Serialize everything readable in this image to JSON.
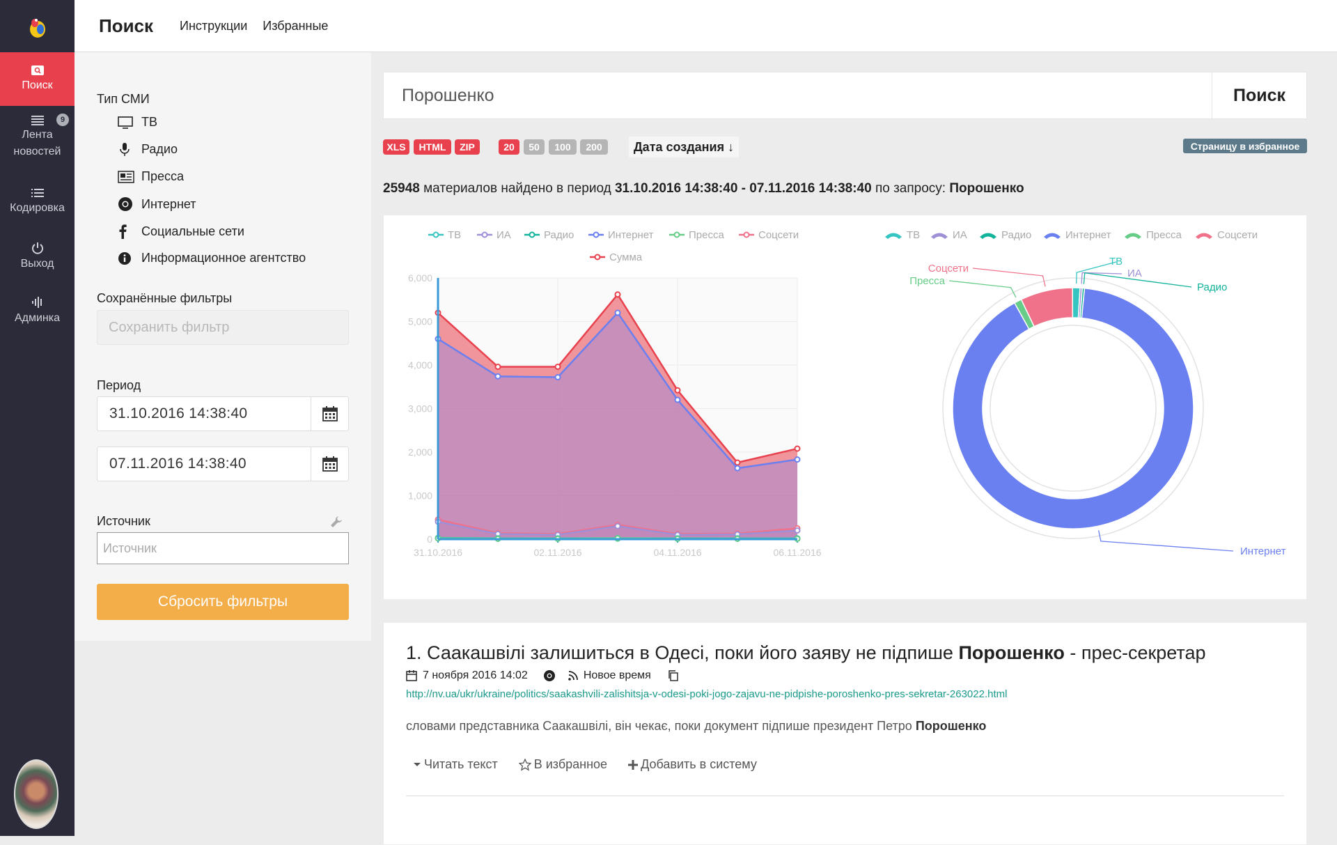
{
  "sidebar": {
    "items": [
      {
        "label": "Поиск",
        "icon": "search-icon"
      },
      {
        "label": "Лента новостей",
        "icon": "list-icon",
        "badge": "9"
      },
      {
        "label": "Кодировка",
        "icon": "list-icon"
      },
      {
        "label": "Выход",
        "icon": "power-icon"
      },
      {
        "label": "Админка",
        "icon": "equalizer-icon"
      }
    ]
  },
  "topbar": {
    "brand": "Поиск",
    "links": [
      "Инструкции",
      "Избранные"
    ]
  },
  "filters": {
    "media_type_label": "Тип СМИ",
    "media_types": [
      "ТВ",
      "Радио",
      "Пресса",
      "Интернет",
      "Социальные сети",
      "Информационное агентство"
    ],
    "saved_filters_label": "Сохранённые фильтры",
    "saved_filter_placeholder": "Сохранить фильтр",
    "period_label": "Период",
    "date_from": "31.10.2016 14:38:40",
    "date_to": "07.11.2016 14:38:40",
    "source_label": "Источник",
    "source_placeholder": "Источник",
    "reset_label": "Сбросить фильтры"
  },
  "search": {
    "query": "Порошенко",
    "button": "Поиск"
  },
  "toolbar": {
    "exports": [
      "XLS",
      "HTML",
      "ZIP"
    ],
    "page_sizes": [
      "20",
      "50",
      "100",
      "200"
    ],
    "sort_label": "Дата создания ↓",
    "fav_page_label": "Страницу в избранное"
  },
  "summary": {
    "count": "25948",
    "text1": " материалов найдено в период ",
    "period": "31.10.2016 14:38:40 - 07.11.2016 14:38:40",
    "text2": " по запросу: ",
    "query": "Порошенко"
  },
  "colors": {
    "accent": "#e8414d",
    "sidebar": "#2b2b3a",
    "orange": "#f3ad49"
  },
  "chart_data": [
    {
      "type": "area",
      "x": [
        "31.10.2016",
        "01.11.2016",
        "02.11.2016",
        "03.11.2016",
        "04.11.2016",
        "05.11.2016",
        "06.11.2016"
      ],
      "xticks": [
        "31.10.2016",
        "02.11.2016",
        "04.11.2016",
        "06.11.2016"
      ],
      "ylim": [
        0,
        6000
      ],
      "yticks": [
        "0",
        "1,000",
        "2,000",
        "3,000",
        "4,000",
        "5,000",
        "6,000"
      ],
      "series": [
        {
          "name": "ТВ",
          "color": "#36c5c0",
          "values": [
            30,
            20,
            20,
            25,
            20,
            20,
            20
          ]
        },
        {
          "name": "ИА",
          "color": "#9f8fd6",
          "values": [
            400,
            120,
            100,
            300,
            100,
            110,
            200
          ]
        },
        {
          "name": "Радио",
          "color": "#11b39b",
          "values": [
            20,
            10,
            10,
            15,
            10,
            10,
            10
          ]
        },
        {
          "name": "Интернет",
          "color": "#6a7ff0",
          "values": [
            4600,
            3740,
            3720,
            5200,
            3200,
            1630,
            1830
          ]
        },
        {
          "name": "Пресса",
          "color": "#66cc88",
          "values": [
            20,
            10,
            10,
            20,
            10,
            10,
            10
          ]
        },
        {
          "name": "Соцсети",
          "color": "#f0718a",
          "values": [
            450,
            140,
            120,
            330,
            120,
            130,
            250
          ]
        },
        {
          "name": "Сумма",
          "color": "#e8414d",
          "values": [
            5200,
            3960,
            3960,
            5620,
            3420,
            1760,
            2080
          ]
        }
      ]
    },
    {
      "type": "pie",
      "series": [
        {
          "name": "ТВ",
          "color": "#36c5c0",
          "value": 1
        },
        {
          "name": "ИА",
          "color": "#9f8fd6",
          "value": 0.3
        },
        {
          "name": "Радио",
          "color": "#11b39b",
          "value": 0.3
        },
        {
          "name": "Интернет",
          "color": "#6a7ff0",
          "value": 90.4
        },
        {
          "name": "Пресса",
          "color": "#66cc88",
          "value": 1
        },
        {
          "name": "Соцсети",
          "color": "#f0718a",
          "value": 7
        }
      ]
    }
  ],
  "result": {
    "title_prefix": "1. Саакашвілі залишиться в Одесі, поки його заяву не підпише ",
    "title_bold": "Порошенко",
    "title_suffix": " - прес-секретар",
    "date": "7 ноября 2016 14:02",
    "source": "Новое время",
    "url": "http://nv.ua/ukr/ukraine/politics/saakashvili-zalishitsja-v-odesi-poki-jogo-zajavu-ne-pidpishe-poroshenko-pres-sekretar-263022.html",
    "snippet": "словами представника Саакашвілі, він чекає, поки документ підпише президент Петро ",
    "snippet_bold": "Порошенко",
    "actions": [
      "Читать текст",
      "В избранное",
      "Добавить в систему"
    ]
  }
}
